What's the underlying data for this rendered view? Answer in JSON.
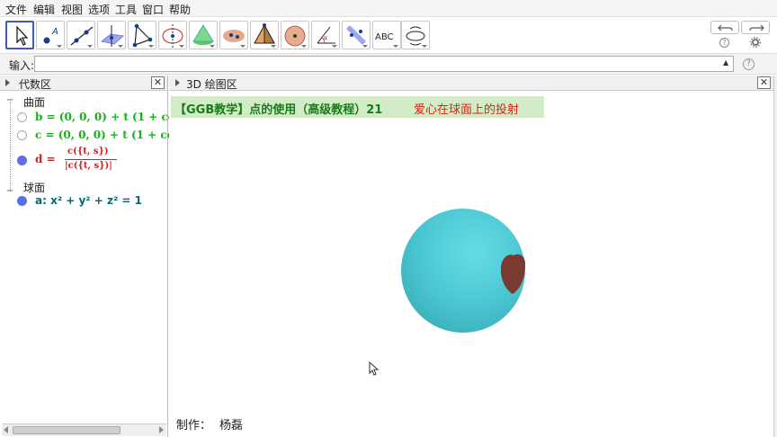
{
  "menu": [
    "文件",
    "编辑",
    "视图",
    "选项",
    "工具",
    "窗口",
    "帮助"
  ],
  "toolbar": {
    "tools": [
      {
        "name": "move-tool-icon",
        "active": true
      },
      {
        "name": "point-tool-icon"
      },
      {
        "name": "line-tool-icon"
      },
      {
        "name": "perpendicular-plane-tool-icon"
      },
      {
        "name": "polygon-tool-icon"
      },
      {
        "name": "circle-axis-tool-icon"
      },
      {
        "name": "pyramid-tool-icon"
      },
      {
        "name": "intersect-surfaces-tool-icon"
      },
      {
        "name": "tetrahedron-tool-icon"
      },
      {
        "name": "sphere-tool-icon"
      },
      {
        "name": "angle-tool-icon"
      },
      {
        "name": "reflect-tool-icon"
      },
      {
        "name": "text-tool-icon",
        "label": "ABC"
      },
      {
        "name": "rotate-view-tool-icon"
      }
    ],
    "undo_icon": "undo-icon",
    "redo_icon": "redo-icon"
  },
  "input": {
    "label": "输入:",
    "value": "",
    "help": "?"
  },
  "algebra": {
    "title": "代数区",
    "categories": [
      {
        "label": "曲面",
        "items": [
          {
            "text": "b = (0, 0, 0) + t (1 + co",
            "color": "#11b511",
            "visible": false
          },
          {
            "text": "c = (0, 0, 0) + t (1 + co",
            "color": "#11b511",
            "visible": false
          },
          {
            "name": "d =",
            "numerator": "c({t, s})",
            "denominator": "|c({t, s})|",
            "color": "#cc2222",
            "visible": true
          }
        ]
      },
      {
        "label": "球面",
        "items": [
          {
            "text": "a: x² + y² + z² = 1",
            "color": "#066a6f",
            "visible": true
          }
        ]
      }
    ]
  },
  "graphics": {
    "title": "3D 绘图区",
    "banner": {
      "part1": "【GGB教学】点的使用（高级教程）21",
      "part2": "爱心在球面上的投射",
      "part1_color": "#1b7a1b",
      "part2_color": "#dd2211"
    },
    "author_label": "制作：",
    "author_name": "杨磊",
    "sphere_color": "#4fcbd6",
    "heart_color": "#7a3a32"
  }
}
